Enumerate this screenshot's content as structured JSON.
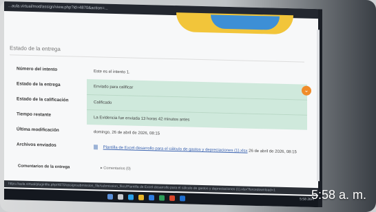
{
  "browser": {
    "url": "...aula.virtual/mod/assign/view.php?id=4870&action=..."
  },
  "page": {
    "section_title": "Estado de la entrega"
  },
  "submission": {
    "rows": [
      {
        "label": "Número del intento",
        "value": "Este es el intento 1."
      },
      {
        "label": "Estado de la entrega",
        "value": "Enviado para calificar"
      },
      {
        "label": "Estado de la calificación",
        "value": "Calificado"
      },
      {
        "label": "Tiempo restante",
        "value": "La Evidencia fue enviada 13 horas 42 minutos antes"
      },
      {
        "label": "Última modificación",
        "value": "domingo, 26 de abril de 2026, 08:15"
      },
      {
        "label": "Archivos enviados",
        "value": "Plantilla de Excel-desarrollo para el cálculo de gastos y depreciaciones (1).xlsx",
        "file_date": "26 de abril de 2026, 08:15"
      }
    ],
    "comments_label": "Comentarios de la entrega",
    "comments_value": "▸ Comentarios (0)"
  },
  "statusbar": {
    "text": "https://aula.virtual/pluginfile.php/4870/assignsubmission_file/submission_files/Plantilla de Excel-desarrollo para el cálculo de gastos y depreciaciones (1).xlsx?forcedownload=1"
  },
  "taskbar": {
    "tray_lang": "ESP\nLAA",
    "tray_time": "5:58\n26/4"
  },
  "overlay": {
    "time": "5:58 a. m."
  },
  "colors": {
    "green_row": "#cfe9dc",
    "accent_orange": "#f08c2a",
    "link_blue": "#3a63b0"
  }
}
